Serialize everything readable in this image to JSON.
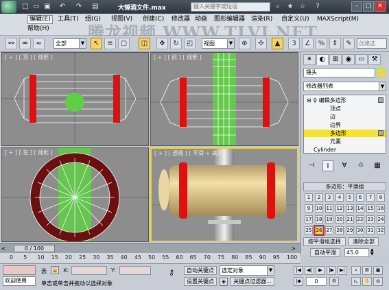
{
  "window": {
    "title": "大锤酒文件.max",
    "search_placeholder": "键入关键字或短语"
  },
  "menus": {
    "row1": [
      "编辑(E)",
      "工具(T)",
      "组(G)",
      "视图(V)",
      "创建(C)",
      "修改器",
      "动画",
      "图形编辑器",
      "渲染(R)",
      "自定义(U)",
      "MAXScript(M)"
    ],
    "row2": [
      "帮助(H)"
    ]
  },
  "watermark": "腾龙视频 WWW.TLVI.NET",
  "toolbar": {
    "selection_filter": "全部",
    "ref_coord": "视图",
    "named_sel": "创建选"
  },
  "viewports": {
    "top": "[ + ] [ 顶 ] [ 线框 ]",
    "front": "[ + ] [ 前 ] [ 线框 ]",
    "left": "[ + ] [ 左 ] [ 线框 ]",
    "persp": "[ + ] [ 透视 ] [ 平滑 + 高光 ]"
  },
  "command_panel": {
    "object_name": "锤头",
    "modifier_list": "修改器列表",
    "stack": [
      {
        "label": "编辑多边形",
        "level": 0
      },
      {
        "label": "顶点",
        "level": 1
      },
      {
        "label": "边",
        "level": 1
      },
      {
        "label": "边界",
        "level": 1
      },
      {
        "label": "多边形",
        "level": 1,
        "selected": true
      },
      {
        "label": "元素",
        "level": 1
      },
      {
        "label": "Cylinder",
        "level": -1
      }
    ],
    "rollout_title": "多边形：平滑组",
    "smoothing_groups": [
      "1",
      "2",
      "3",
      "4",
      "5",
      "6",
      "7",
      "8",
      "9",
      "10",
      "11",
      "12",
      "13",
      "14",
      "15",
      "16",
      "17",
      "18",
      "19",
      "20",
      "21",
      "22",
      "23",
      "24",
      "25",
      "26",
      "27",
      "28",
      "29",
      "30",
      "31",
      "32"
    ],
    "highlighted_group": "26",
    "select_by_sg": "按平滑组选择",
    "clear_all": "清除全部",
    "auto_smooth": "自动平滑",
    "auto_smooth_value": "45.0"
  },
  "timeline": {
    "frame_label": "0 / 100",
    "ticks": [
      "0",
      "5",
      "10",
      "15",
      "20",
      "25",
      "30",
      "35",
      "40",
      "45",
      "50",
      "55",
      "60",
      "65",
      "70",
      "75",
      "80",
      "85",
      "90",
      "95",
      "100"
    ]
  },
  "status": {
    "welcome": "欢迎使用",
    "select_label": "选",
    "x_label": "X:",
    "y_label": "Y:",
    "prompt": "单击或单击并拖动以选择对象",
    "auto_key": "自动关键点",
    "selected_obj": "选定对象",
    "set_key": "设置关键点",
    "key_filters": "关键点过滤器...",
    "frame": "0"
  },
  "colors": {
    "accent_yellow": "#f5e13a",
    "red_edge": "#e11010",
    "green_sel": "#5fcf46"
  }
}
